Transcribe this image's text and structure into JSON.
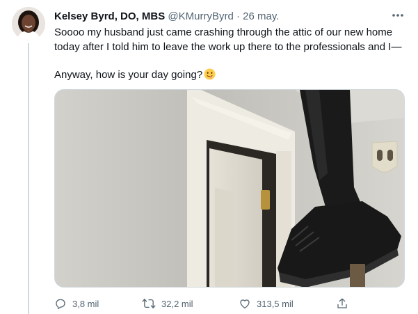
{
  "tweet": {
    "author_name": "Kelsey Byrd, DO, MBS",
    "author_handle": "@KMurryByrd",
    "separator": "·",
    "date": "26 may.",
    "text_line1": "Soooo my husband just came crashing through the attic of our new home today after I told him to leave the work up there to the professionals and I—",
    "text_line2": "Anyway, how is your day going?",
    "emoji": "drooling-face-emoji",
    "more_icon": "more-horizontal-icon"
  },
  "stats": {
    "replies": "3,8 mil",
    "retweets": "32,2 mil",
    "likes": "313,5 mil"
  },
  "colors": {
    "text": "#0f1419",
    "secondary": "#536471",
    "border": "#cfd9de"
  }
}
